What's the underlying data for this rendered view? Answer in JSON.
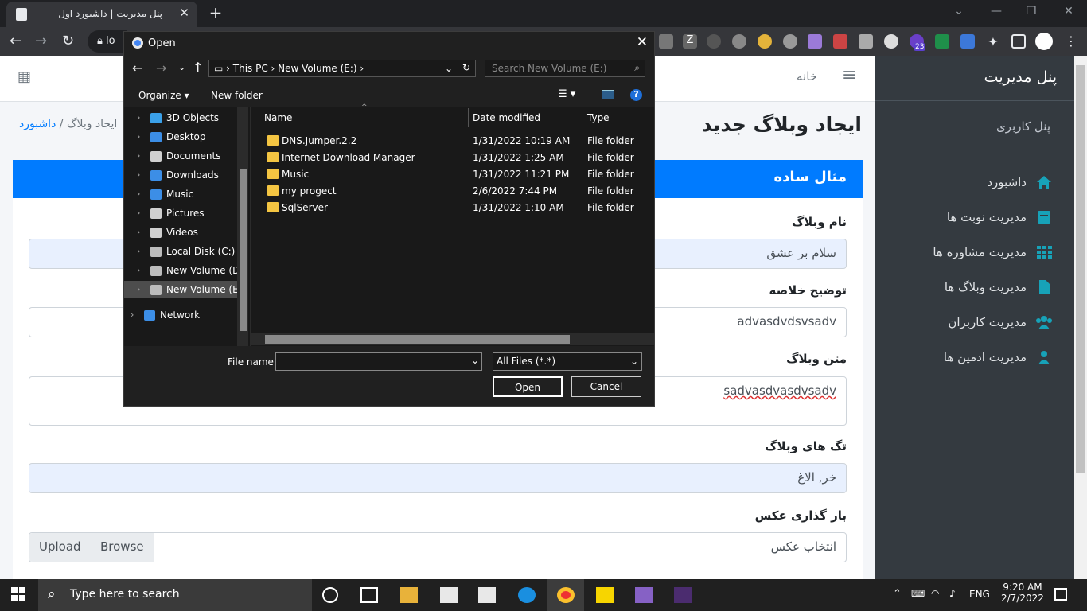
{
  "browser": {
    "tab_title": "پنل مدیریت | داشبورد اول",
    "tab_close": "✕",
    "new_tab": "+",
    "omnibox_text": "lo",
    "win_min": "—",
    "win_max": "❐",
    "win_close": "✕",
    "ext_badge_count": "23"
  },
  "topnav": {
    "home_link": "خانه",
    "menu_icon": "≡",
    "grid_icon": "▦"
  },
  "sidebar": {
    "brand": "پنل مدیریت",
    "user_panel": "پنل کاربری",
    "items": [
      {
        "label": "داشبورد",
        "icon": "home-icon"
      },
      {
        "label": "مدیریت نوبت ها",
        "icon": "inbox-icon"
      },
      {
        "label": "مدیریت مشاوره ها",
        "icon": "grid-icon"
      },
      {
        "label": "مدیریت وبلاگ ها",
        "icon": "file-icon"
      },
      {
        "label": "مدیریت کاربران",
        "icon": "users-icon"
      },
      {
        "label": "مدیریت ادمین ها",
        "icon": "user-icon"
      }
    ]
  },
  "content": {
    "page_title": "ایجاد وبلاگ جدید",
    "breadcrumb_home": "داشبورد",
    "breadcrumb_sep": "/",
    "breadcrumb_current": "ایجاد وبلاگ",
    "card_title": "مثال ساده",
    "fields": {
      "name_label": "نام وبلاگ",
      "name_value": "سلام بر عشق",
      "summary_label": "توضیح خلاصه",
      "summary_value": "advasdvdsvsadv",
      "body_label": "متن وبلاگ",
      "body_value": "sadvasdvasdvsadv",
      "tags_label": "تگ های وبلاگ",
      "tags_value": "خر, الاغ",
      "image_label": "بار گذاری عکس",
      "image_placeholder": "انتخاب عکس",
      "upload_btn": "Upload",
      "browse_btn": "Browse"
    }
  },
  "dialog": {
    "title": "Open",
    "close": "✕",
    "path": [
      "This PC",
      "New Volume (E:)"
    ],
    "search_placeholder": "Search New Volume (E:)",
    "organize": "Organize ▾",
    "new_folder": "New folder",
    "help": "?",
    "tree": [
      {
        "label": "3D Objects",
        "color": "#3aa0e8"
      },
      {
        "label": "Desktop",
        "color": "#3c8ee6"
      },
      {
        "label": "Documents",
        "color": "#d0d0d0"
      },
      {
        "label": "Downloads",
        "color": "#3c8ee6"
      },
      {
        "label": "Music",
        "color": "#3c8ee6"
      },
      {
        "label": "Pictures",
        "color": "#d0d0d0"
      },
      {
        "label": "Videos",
        "color": "#d0d0d0"
      },
      {
        "label": "Local Disk (C:)",
        "color": "#bcbcbc"
      },
      {
        "label": "New Volume (D:)",
        "color": "#bcbcbc"
      },
      {
        "label": "New Volume (E:)",
        "color": "#bcbcbc"
      },
      {
        "label": "Network",
        "color": "#3c8ee6"
      }
    ],
    "columns": {
      "name": "Name",
      "date": "Date modified",
      "type": "Type"
    },
    "files": [
      {
        "name": "DNS.Jumper.2.2",
        "date": "1/31/2022 10:19 AM",
        "type": "File folder"
      },
      {
        "name": "Internet Download Manager",
        "date": "1/31/2022 1:25 AM",
        "type": "File folder"
      },
      {
        "name": "Music",
        "date": "1/31/2022 11:21 PM",
        "type": "File folder"
      },
      {
        "name": "my progect",
        "date": "2/6/2022 7:44 PM",
        "type": "File folder"
      },
      {
        "name": "SqlServer",
        "date": "1/31/2022 1:10 AM",
        "type": "File folder"
      }
    ],
    "filename_label": "File name:",
    "filename_value": "",
    "filetype": "All Files (*.*)",
    "open_btn": "Open",
    "cancel_btn": "Cancel"
  },
  "taskbar": {
    "search_placeholder": "Type here to search",
    "lang": "ENG",
    "time": "9:20 AM",
    "date": "2/7/2022"
  }
}
